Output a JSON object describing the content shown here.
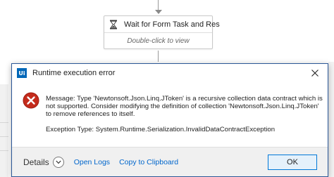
{
  "workflow": {
    "activity": {
      "title": "Wait for Form Task and Res",
      "hint": "Double-click to view",
      "icon": "hourglass-icon"
    }
  },
  "dialog": {
    "title": "Runtime execution error",
    "app_icon_label": "Ui",
    "message": "Message: Type 'Newtonsoft.Json.Linq.JToken' is a recursive collection data contract which is not supported. Consider modifying the definition of collection 'Newtonsoft.Json.Linq.JToken' to remove references to itself.",
    "exception": "Exception Type: System.Runtime.Serialization.InvalidDataContractException",
    "footer": {
      "details_label": "Details",
      "open_logs": "Open Logs",
      "copy_clipboard": "Copy to Clipboard",
      "ok_label": "OK"
    }
  },
  "colors": {
    "accent": "#0067b8",
    "error": "#c42b1c",
    "link": "#0066cc"
  }
}
